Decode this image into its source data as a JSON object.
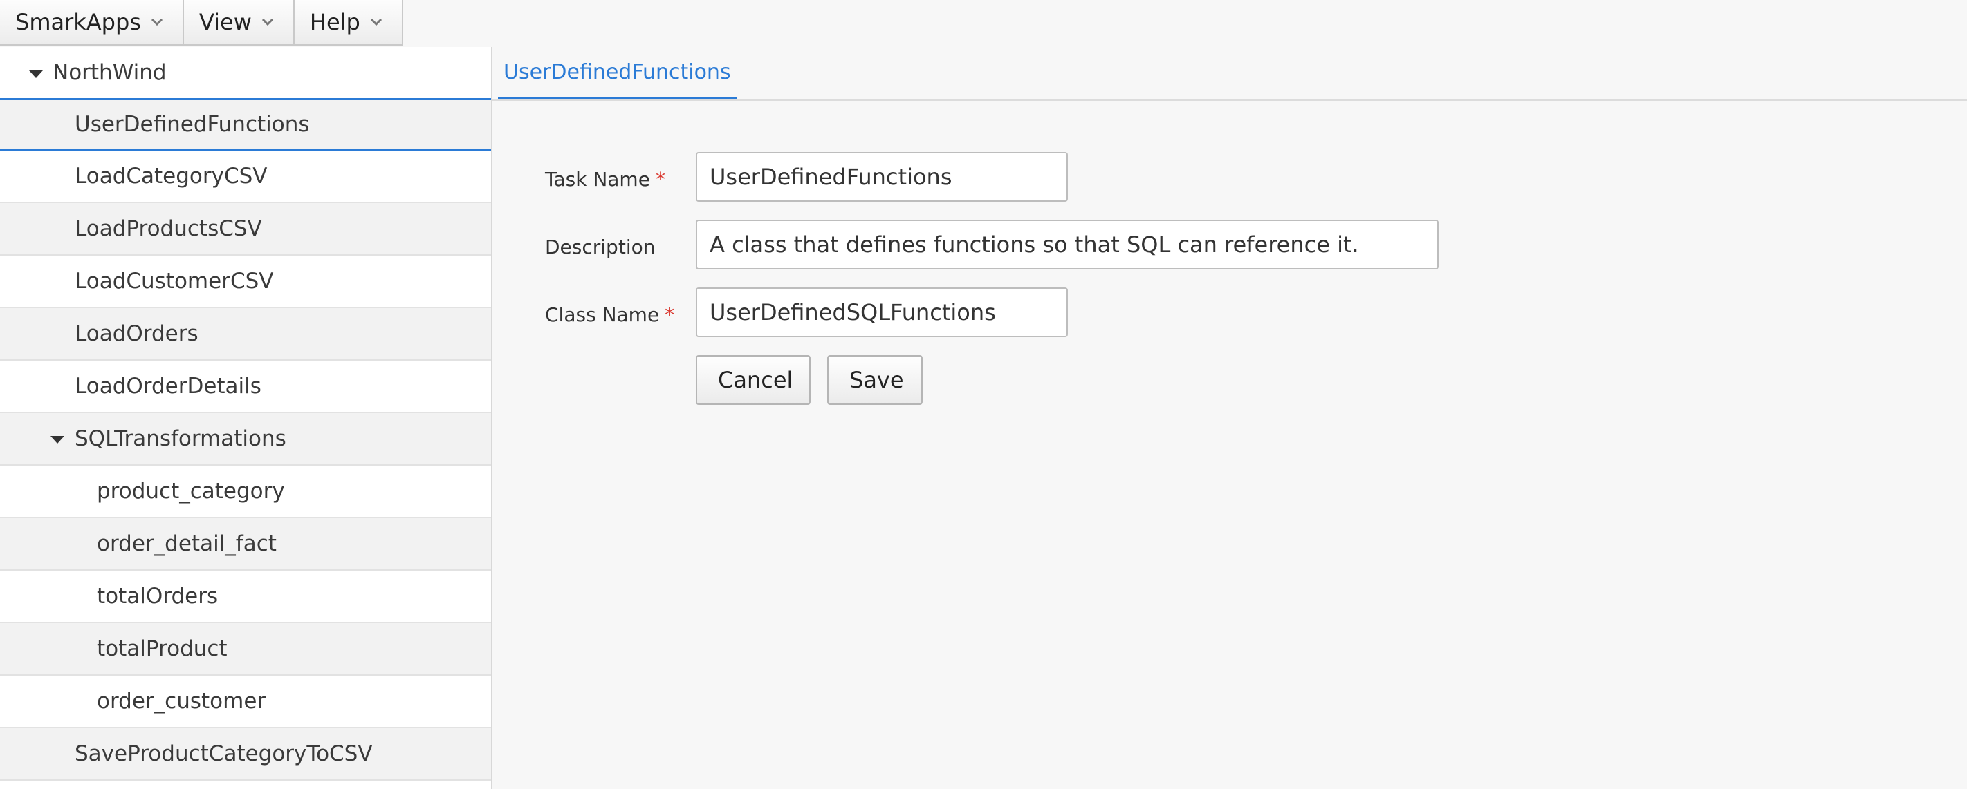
{
  "menus": [
    {
      "label": "SmarkApps",
      "icon": "chevron-down-icon"
    },
    {
      "label": "View",
      "icon": "chevron-down-icon"
    },
    {
      "label": "Help",
      "icon": "chevron-down-icon"
    }
  ],
  "tree": {
    "root": {
      "label": "NorthWind",
      "expanded": true
    },
    "items": [
      {
        "label": "UserDefinedFunctions",
        "selected": true
      },
      {
        "label": "LoadCategoryCSV"
      },
      {
        "label": "LoadProductsCSV"
      },
      {
        "label": "LoadCustomerCSV"
      },
      {
        "label": "LoadOrders"
      },
      {
        "label": "LoadOrderDetails"
      },
      {
        "label": "SQLTransformations",
        "expanded": true
      },
      {
        "label": "product_category"
      },
      {
        "label": "order_detail_fact"
      },
      {
        "label": "totalOrders"
      },
      {
        "label": "totalProduct"
      },
      {
        "label": "order_customer"
      },
      {
        "label": "SaveProductCategoryToCSV"
      }
    ]
  },
  "tab": {
    "label": "UserDefinedFunctions"
  },
  "form": {
    "task_name": {
      "label": "Task Name",
      "required_mark": "*",
      "value": "UserDefinedFunctions"
    },
    "description": {
      "label": "Description",
      "value": "A class that defines functions so that SQL can reference it."
    },
    "class_name": {
      "label": "Class Name",
      "required_mark": "*",
      "value": "UserDefinedSQLFunctions"
    },
    "cancel_label": "Cancel",
    "save_label": "Save"
  },
  "colors": {
    "accent": "#2b7bd6",
    "required": "#d9342b"
  }
}
